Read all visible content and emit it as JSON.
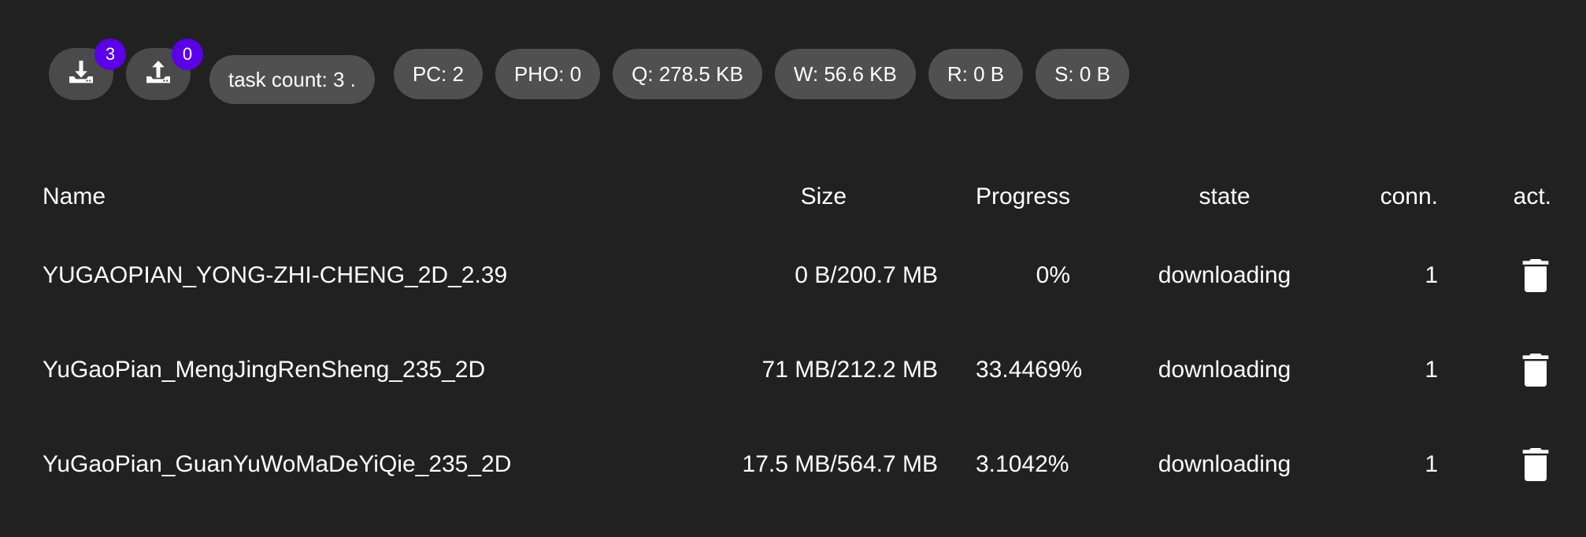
{
  "toolbar": {
    "download_badge": "3",
    "upload_badge": "0",
    "task_count": "task count: 3 .",
    "stats": [
      "PC: 2",
      "PHO: 0",
      "Q: 278.5 KB",
      "W: 56.6 KB",
      "R: 0 B",
      "S: 0 B"
    ]
  },
  "table": {
    "headers": {
      "name": "Name",
      "size": "Size",
      "progress": "Progress",
      "state": "state",
      "conn": "conn.",
      "act": "act."
    },
    "rows": [
      {
        "name": "YUGAOPIAN_YONG-ZHI-CHENG_2D_2.39",
        "size": "0 B/200.7 MB",
        "progress": "0%",
        "state": "downloading",
        "conn": "1"
      },
      {
        "name": "YuGaoPian_MengJingRenSheng_235_2D",
        "size": "71 MB/212.2 MB",
        "progress": "33.4469%",
        "state": "downloading",
        "conn": "1"
      },
      {
        "name": "YuGaoPian_GuanYuWoMaDeYiQie_235_2D",
        "size": "17.5 MB/564.7 MB",
        "progress": "3.1042%",
        "state": "downloading",
        "conn": "1"
      }
    ]
  },
  "icons": {
    "download": "download-icon",
    "upload": "upload-icon",
    "delete": "trash-icon"
  },
  "colors": {
    "background": "#212121",
    "chip": "#505050",
    "badge": "#5b00e8"
  }
}
